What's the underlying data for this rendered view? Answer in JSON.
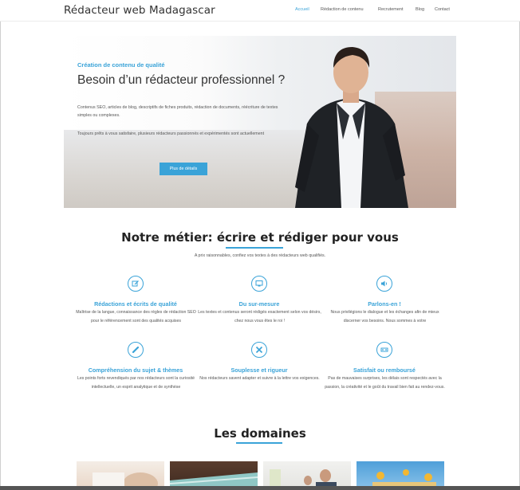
{
  "header": {
    "brand": "Rédacteur web Madagascar",
    "nav": [
      "Accueil",
      "Rédaction de contenu",
      "Recrutement",
      "Blog",
      "Contact"
    ]
  },
  "hero": {
    "kicker": "Création de contenu de qualité",
    "title": "Besoin d’un rédacteur professionnel ?",
    "p1": "Contenus SEO, articles de blog, descriptifs de fiches produits, rédaction de documents, réécriture de textes simples ou complexes.",
    "p2": "Toujours prêts à vous satisfaire, plusieurs rédacteurs passionnés et expérimentés sont actuellement",
    "button": "Plus de détails"
  },
  "section": {
    "title": "Notre métier: écrire et rédiger pour vous",
    "subtitle": "A prix raisonnables, confiez vos textes à des rédacteurs web qualifiés."
  },
  "features": [
    {
      "icon": "edit-icon",
      "title": "Rédactions et écrits de qualité",
      "desc": "Maîtrise de la langue, connaissance des règles de rédaction SEO pour le référencement sont des qualités acquises"
    },
    {
      "icon": "monitor-icon",
      "title": "Du sur-mesure",
      "desc": "Les textes et contenus seront rédigés exactement selon vos désirs, chez nous vous êtes le roi !"
    },
    {
      "icon": "speaker-icon",
      "title": "Parlons-en !",
      "desc": "Nous privilégions le dialogue et les échanges afin de mieux discerner vos besoins. Nous sommes à votre"
    },
    {
      "icon": "link-icon",
      "title": "Compréhension du sujet & thèmes",
      "desc": "Les points forts revendiqués par nos rédacteurs sont la curiosité intellectuelle, un esprit analytique et de synthèse"
    },
    {
      "icon": "tools-icon",
      "title": "Souplesse et rigueur",
      "desc": "Nos rédacteurs savent adapter et suivre à la lettre vos exigences."
    },
    {
      "icon": "support-icon",
      "title": "Satisfait ou remboursé",
      "desc": "Pas de mauvaises surprises, les délais sont respectés avec la passion, la créativité et le goût du travail bien fait au rendez-vous."
    }
  ],
  "domains": {
    "title": "Les domaines"
  },
  "colors": {
    "accent": "#3aa3d8",
    "text": "#333333"
  }
}
